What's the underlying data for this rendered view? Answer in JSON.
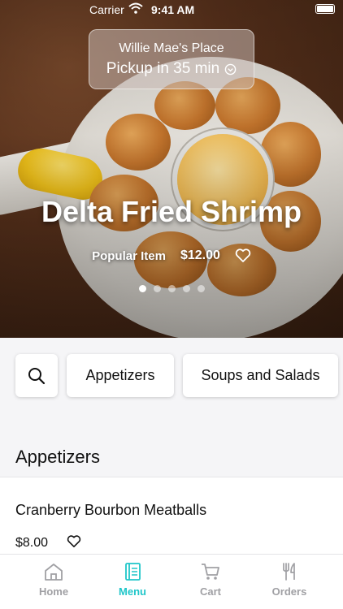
{
  "status_bar": {
    "carrier": "Carrier",
    "time": "9:41 AM"
  },
  "location": {
    "name": "Willie Mae's Place",
    "pickup": "Pickup in 35 min"
  },
  "hero": {
    "title": "Delta Fried Shrimp",
    "tag": "Popular Item",
    "price": "$12.00",
    "dots_total": 5,
    "active_dot": 1
  },
  "categories": {
    "search_icon": "search-icon",
    "items": [
      "Appetizers",
      "Soups and Salads"
    ]
  },
  "section": {
    "title": "Appetizers"
  },
  "menu_item": {
    "name": "Cranberry Bourbon Meatballs",
    "price": "$8.00"
  },
  "tabs": [
    {
      "label": "Home",
      "icon": "home-icon"
    },
    {
      "label": "Menu",
      "icon": "menu-icon"
    },
    {
      "label": "Cart",
      "icon": "cart-icon"
    },
    {
      "label": "Orders",
      "icon": "orders-icon"
    }
  ],
  "colors": {
    "accent": "#1fc6c9",
    "inactive": "#a0a0a4"
  }
}
